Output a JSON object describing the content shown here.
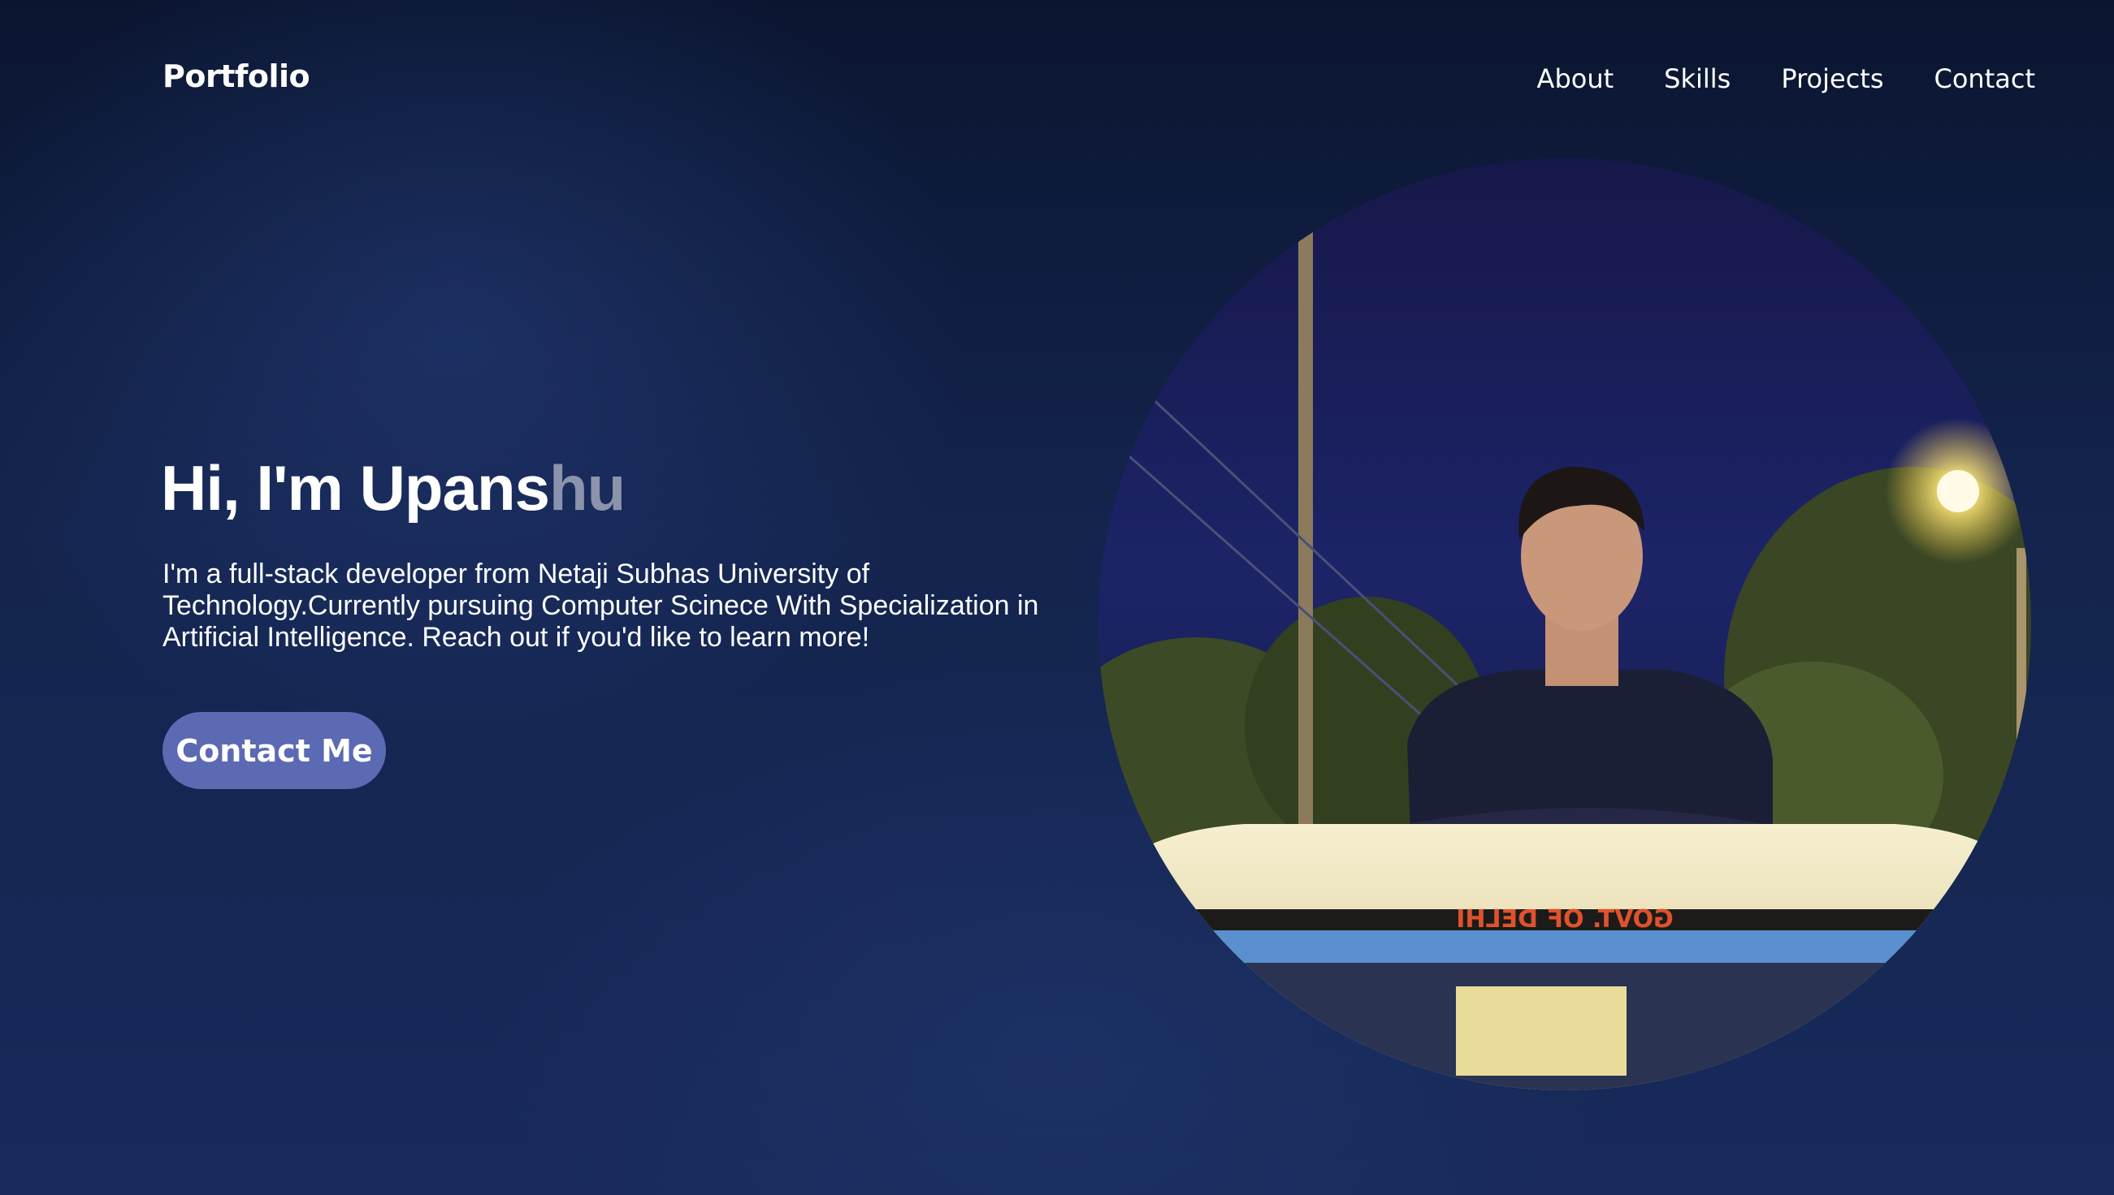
{
  "nav": {
    "brand": "Portfolio",
    "links": [
      "About",
      "Skills",
      "Projects",
      "Contact"
    ]
  },
  "hero": {
    "greeting_solid": "Hi, I'm Upans",
    "greeting_fade": "hu",
    "description": "I'm a full-stack developer from Netaji Subhas University of Technology.Currently pursuing Computer Scinece With Specialization in Artificial Intelligence. Reach out if you'd like to learn more!",
    "cta_label": "Contact Me"
  },
  "photo": {
    "car_text": "GOVT. OF DELHI"
  },
  "colors": {
    "background": "#14244e",
    "accent": "#5c69b3",
    "text": "#ffffff",
    "faded_text": "#8b93ad"
  }
}
